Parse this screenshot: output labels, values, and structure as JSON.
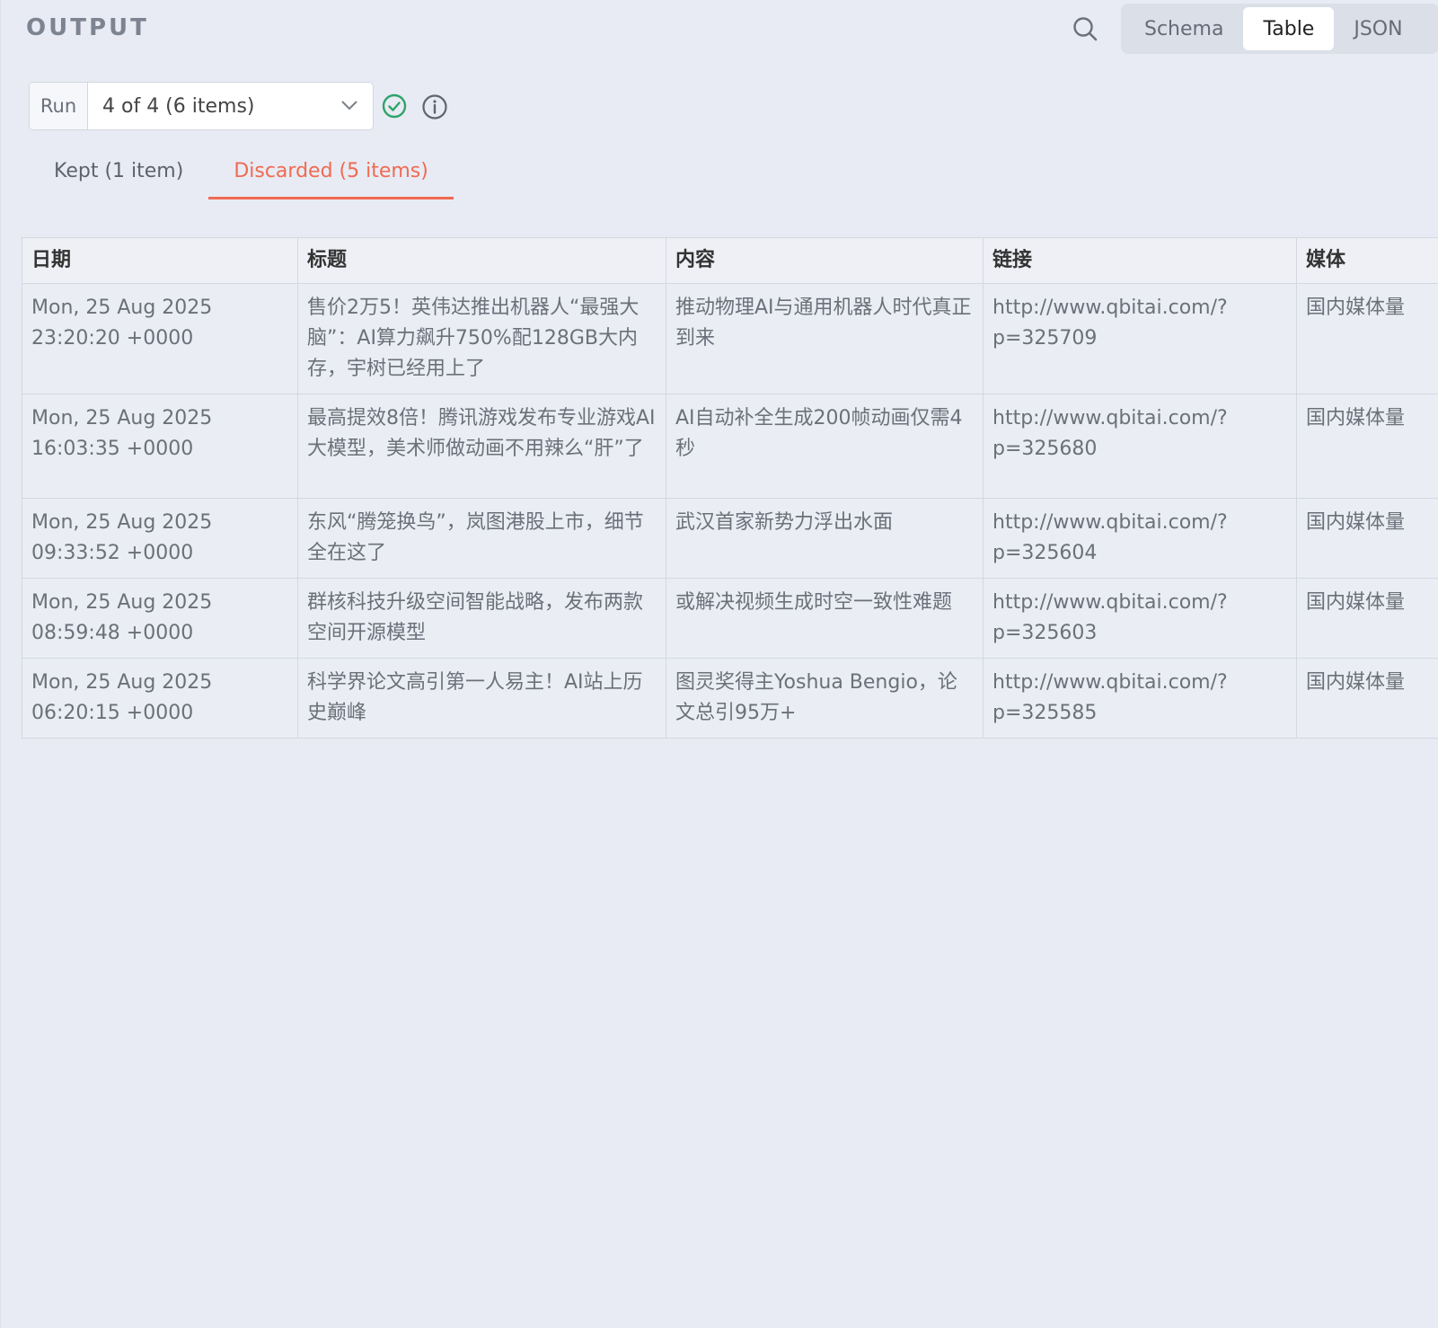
{
  "panel": {
    "title": "OUTPUT"
  },
  "view_toggle": {
    "options": [
      "Schema",
      "Table",
      "JSON"
    ],
    "selected": "Table"
  },
  "run_selector": {
    "label": "Run",
    "value": "4 of 4 (6 items)"
  },
  "tabs": [
    {
      "label": "Kept (1 item)",
      "active": false
    },
    {
      "label": "Discarded (5 items)",
      "active": true
    }
  ],
  "table": {
    "columns": [
      "日期",
      "标题",
      "内容",
      "链接",
      "媒体"
    ],
    "rows": [
      [
        "Mon, 25 Aug 2025 23:20:20 +0000",
        "售价2万5！英伟达推出机器人“最强大脑”：AI算力飙升750%配128GB大内存，宇树已经用上了",
        "推动物理AI与通用机器人时代真正到来",
        "http://www.qbitai.com/?p=325709",
        "国内媒体量"
      ],
      [
        "Mon, 25 Aug 2025 16:03:35 +0000",
        "最高提效8倍！腾讯游戏发布专业游戏AI大模型，美术师做动画不用辣么“肝”了",
        "AI自动补全生成200帧动画仅需4秒",
        "http://www.qbitai.com/?p=325680",
        "国内媒体量"
      ],
      [
        "Mon, 25 Aug 2025 09:33:52 +0000",
        "东风“腾笼换鸟”，岚图港股上市，细节全在这了",
        "武汉首家新势力浮出水面",
        "http://www.qbitai.com/?p=325604",
        "国内媒体量"
      ],
      [
        "Mon, 25 Aug 2025 08:59:48 +0000",
        "群核科技升级空间智能战略，发布两款空间开源模型",
        "或解决视频生成时空一致性难题",
        "http://www.qbitai.com/?p=325603",
        "国内媒体量"
      ],
      [
        "Mon, 25 Aug 2025 06:20:15 +0000",
        "科学界论文高引第一人易主！AI站上历史巅峰",
        "图灵奖得主Yoshua Bengio，论文总引95万+",
        "http://www.qbitai.com/?p=325585",
        "国内媒体量"
      ]
    ]
  },
  "colors": {
    "accent": "#f06a52",
    "success": "#2fa36b",
    "background": "#e8ebf3"
  }
}
